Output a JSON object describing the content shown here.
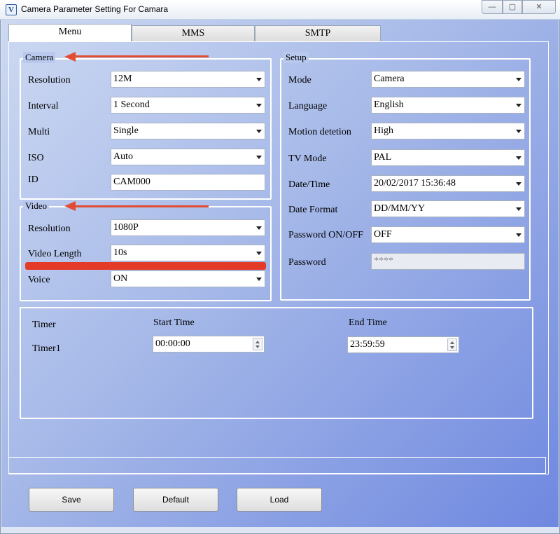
{
  "window": {
    "title": "Camera Parameter Setting For  Camara",
    "icon": "camera-app-icon",
    "controls": [
      "minimize-icon",
      "maximize-icon",
      "close-icon"
    ]
  },
  "tabs": [
    {
      "label": "Menu",
      "active": true
    },
    {
      "label": "MMS",
      "active": false
    },
    {
      "label": "SMTP",
      "active": false
    }
  ],
  "camera": {
    "group_label": "Camera",
    "resolution": {
      "label": "Resolution",
      "value": "12M"
    },
    "interval": {
      "label": "Interval",
      "value": "1 Second"
    },
    "multi": {
      "label": "Multi",
      "value": "Single"
    },
    "iso": {
      "label": "ISO",
      "value": "Auto"
    },
    "id": {
      "label": "ID",
      "value": "CAM000"
    }
  },
  "video": {
    "group_label": "Video",
    "resolution": {
      "label": "Resolution",
      "value": "1080P"
    },
    "length": {
      "label": "Video Length",
      "value": "10s"
    },
    "voice": {
      "label": "Voice",
      "value": "ON"
    }
  },
  "setup": {
    "group_label": "Setup",
    "mode": {
      "label": "Mode",
      "value": "Camera"
    },
    "language": {
      "label": "Language",
      "value": "English"
    },
    "motion": {
      "label": "Motion detetion",
      "value": "High"
    },
    "tv_mode": {
      "label": "TV Mode",
      "value": "PAL"
    },
    "datetime": {
      "label": "Date/Time",
      "value": "20/02/2017 15:36:48"
    },
    "date_format": {
      "label": "Date Format",
      "value": "DD/MM/YY"
    },
    "password_onoff": {
      "label": "Password ON/OFF",
      "value": "OFF"
    },
    "password": {
      "label": "Password",
      "value": "****"
    }
  },
  "timer": {
    "header": "Timer",
    "start_header": "Start Time",
    "end_header": "End Time",
    "row_label": "Timer1",
    "start_value": "00:00:00",
    "end_value": "23:59:59"
  },
  "buttons": {
    "save": "Save",
    "default": "Default",
    "load": "Load"
  },
  "annotation_color": "#e14c33"
}
